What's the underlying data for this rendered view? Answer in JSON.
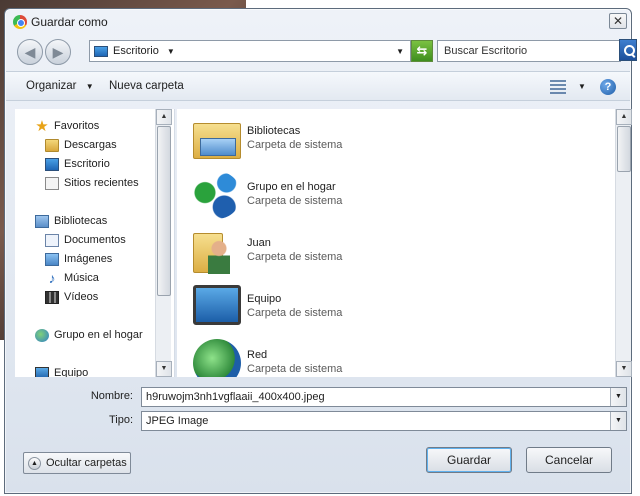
{
  "window": {
    "title": "Guardar como",
    "close_glyph": "✕"
  },
  "address": {
    "location": "Escritorio",
    "search_placeholder": "Buscar Escritorio"
  },
  "toolbar": {
    "organize": "Organizar",
    "new_folder": "Nueva carpeta",
    "help_glyph": "?"
  },
  "nav": {
    "favorites": "Favoritos",
    "downloads": "Descargas",
    "desktop": "Escritorio",
    "recent": "Sitios recientes",
    "libraries": "Bibliotecas",
    "documents": "Documentos",
    "images": "Imágenes",
    "music": "Música",
    "videos": "Vídeos",
    "homegroup": "Grupo en el hogar",
    "computer": "Equipo"
  },
  "items": [
    {
      "name": "Bibliotecas",
      "type": "Carpeta de sistema",
      "icon": "libraries-icon"
    },
    {
      "name": "Grupo en el hogar",
      "type": "Carpeta de sistema",
      "icon": "homegroup-icon"
    },
    {
      "name": "Juan",
      "type": "Carpeta de sistema",
      "icon": "user-folder-icon"
    },
    {
      "name": "Equipo",
      "type": "Carpeta de sistema",
      "icon": "computer-icon"
    },
    {
      "name": "Red",
      "type": "Carpeta de sistema",
      "icon": "network-icon"
    }
  ],
  "form": {
    "name_label": "Nombre:",
    "name_value": "h9ruwojm3nh1vgflaaii_400x400.jpeg",
    "type_label": "Tipo:",
    "type_value": "JPEG Image"
  },
  "footer": {
    "hide_folders": "Ocultar carpetas",
    "save": "Guardar",
    "cancel": "Cancelar"
  }
}
